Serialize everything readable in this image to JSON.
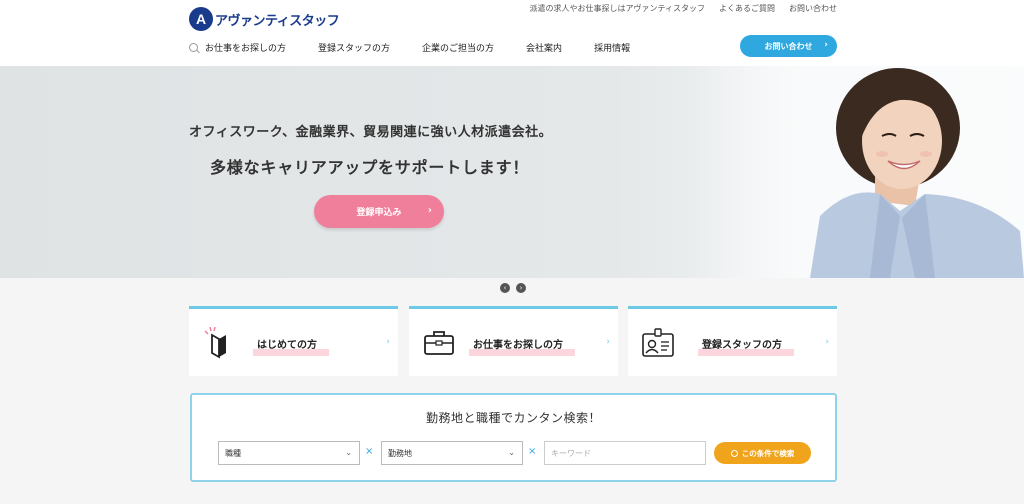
{
  "header": {
    "logo_text": "アヴァンティスタッフ",
    "logo_mark": "A",
    "utility_links": [
      "派遣の求人やお仕事探しはアヴァンティスタッフ",
      "よくあるご質問",
      "お問い合わせ"
    ],
    "nav": [
      "お仕事をお探しの方",
      "登録スタッフの方",
      "企業のご担当の方",
      "会社案内",
      "採用情報"
    ],
    "contact_button": "お問い合わせ"
  },
  "hero": {
    "headline": "オフィスワーク、金融業界、貿易関連に強い人材派遣会社。",
    "subheadline": "多様なキャリアアップをサポートします！",
    "cta": "登録申込み"
  },
  "slider": {
    "prev": "‹",
    "next": "›"
  },
  "cards": [
    {
      "label": "はじめての方",
      "icon": "beginner-mark-icon"
    },
    {
      "label": "お仕事をお探しの方",
      "icon": "briefcase-icon"
    },
    {
      "label": "登録スタッフの方",
      "icon": "id-card-icon"
    }
  ],
  "search": {
    "title": "勤務地と職種でカンタン検索！",
    "select_job": "職種",
    "select_location": "勤務地",
    "keyword_placeholder": "キーワード",
    "button": "この条件で検索",
    "separator": "×"
  },
  "colors": {
    "brand": "#1a3a8c",
    "accent_blue": "#2fa8e0",
    "pink": "#f07f9b",
    "orange": "#f0a41c",
    "card_border": "#6ec9e6"
  }
}
